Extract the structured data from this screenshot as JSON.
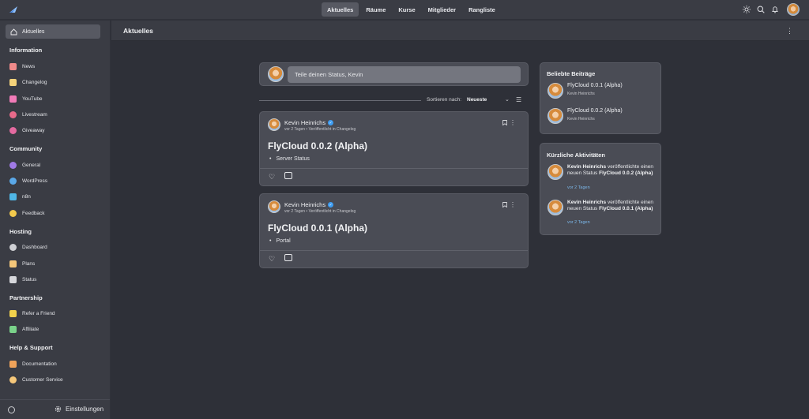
{
  "topnav": {
    "items": [
      {
        "label": "Aktuelles",
        "active": true
      },
      {
        "label": "Räume"
      },
      {
        "label": "Kurse"
      },
      {
        "label": "Mitglieder"
      },
      {
        "label": "Rangliste"
      }
    ],
    "icons": [
      "theme-sun-icon",
      "search-icon",
      "bell-icon",
      "avatar"
    ]
  },
  "sidebar": {
    "active_item": "Aktuelles",
    "sections": [
      {
        "title": "Information",
        "items": [
          {
            "label": "News",
            "icon": "megaphone-icon",
            "color": "#f08a8a"
          },
          {
            "label": "Changelog",
            "icon": "document-icon",
            "color": "#f5d37a"
          },
          {
            "label": "YouTube",
            "icon": "youtube-icon",
            "color": "#f27bb8"
          },
          {
            "label": "Livestream",
            "icon": "livestream-icon",
            "color": "#e86a8a"
          },
          {
            "label": "Giveaway",
            "icon": "giveaway-icon",
            "color": "#e46aa0"
          }
        ]
      },
      {
        "title": "Community",
        "items": [
          {
            "label": "General",
            "icon": "people-icon",
            "color": "#a07ae6"
          },
          {
            "label": "WordPress",
            "icon": "globe-icon",
            "color": "#5aa8e8"
          },
          {
            "label": "n8n",
            "icon": "workflow-icon",
            "color": "#4fb6e6"
          },
          {
            "label": "Feedback",
            "icon": "lightbulb-icon",
            "color": "#f2c94c"
          }
        ]
      },
      {
        "title": "Hosting",
        "items": [
          {
            "label": "Dashboard",
            "icon": "gear-icon",
            "color": "#cfd0d4"
          },
          {
            "label": "Plans",
            "icon": "box-icon",
            "color": "#f5c77a"
          },
          {
            "label": "Status",
            "icon": "rocket-icon",
            "color": "#d6d7db"
          }
        ]
      },
      {
        "title": "Partnership",
        "items": [
          {
            "label": "Refer a Friend",
            "icon": "handshake-icon",
            "color": "#f2d24c"
          },
          {
            "label": "Affiliate",
            "icon": "sparkle-icon",
            "color": "#7ad28a"
          }
        ]
      },
      {
        "title": "Help & Support",
        "items": [
          {
            "label": "Documentation",
            "icon": "books-icon",
            "color": "#f0a35a"
          },
          {
            "label": "Customer Service",
            "icon": "headset-icon",
            "color": "#f5c77a"
          }
        ]
      }
    ],
    "footer": {
      "settings_label": "Einstellungen"
    }
  },
  "header": {
    "title": "Aktuelles"
  },
  "feed": {
    "status_placeholder": "Teile deinen Status, Kevin",
    "sort_label": "Sortieren nach:",
    "sort_value": "Neueste",
    "posts": [
      {
        "author": "Kevin Heinrichs",
        "meta": "vor 2 Tagen • Veröffentlicht in Changelog",
        "title": "FlyCloud 0.0.2 (Alpha)",
        "bullet": "Server Status"
      },
      {
        "author": "Kevin Heinrichs",
        "meta": "vor 2 Tagen • Veröffentlicht in Changelog",
        "title": "FlyCloud 0.0.1 (Alpha)",
        "bullet": "Portal"
      }
    ]
  },
  "popular": {
    "title": "Beliebte Beiträge",
    "items": [
      {
        "title": "FlyCloud 0.0.1 (Alpha)",
        "author": "Kevin Heinrichs"
      },
      {
        "title": "FlyCloud 0.0.2 (Alpha)",
        "author": "Kevin Heinrichs"
      }
    ]
  },
  "activity": {
    "title": "Kürzliche Aktivitäten",
    "items": [
      {
        "author": "Kevin Heinrichs",
        "action": " veröffentlichte einen neuen Status ",
        "target": "FlyCloud 0.0.2 (Alpha)",
        "time": "vor 2 Tagen"
      },
      {
        "author": "Kevin Heinrichs",
        "action": " veröffentlichte einen neuen Status ",
        "target": "FlyCloud 0.0.1 (Alpha)",
        "time": "vor 2 Tagen"
      }
    ]
  }
}
